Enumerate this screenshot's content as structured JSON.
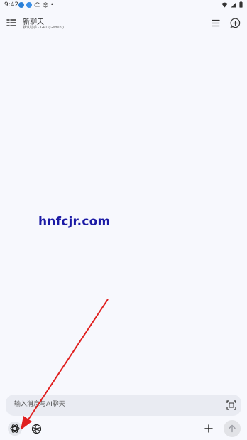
{
  "status_bar": {
    "time": "9:42"
  },
  "header": {
    "title": "新聊天",
    "subtitle": "默认助手 · GPT (Gemini)",
    "icons": {
      "sidebar": "sidebar-menu-icon",
      "list": "list-icon",
      "new_chat": "new-chat-icon"
    }
  },
  "watermark": "hnfcjr.com",
  "composer": {
    "placeholder": "输入消息与AI聊天",
    "scan_icon": "scan-icon"
  },
  "toolbar": {
    "model_icon": "openai-logo-icon",
    "mcp_icon": "globe-icon",
    "add_icon": "plus-icon",
    "send_icon": "arrow-up-icon"
  },
  "colors": {
    "background": "#f7f8fd",
    "watermark": "#1b1aa5",
    "annotation_arrow": "#e02020"
  }
}
